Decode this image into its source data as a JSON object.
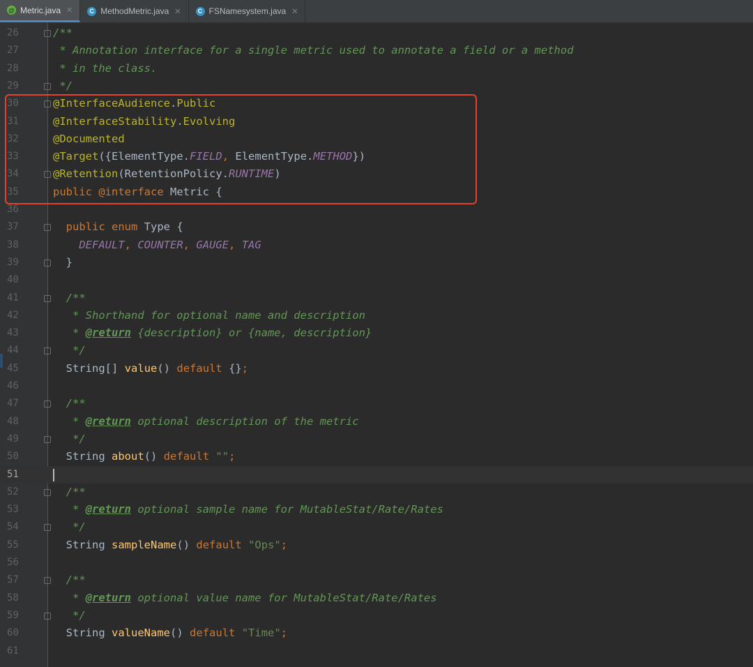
{
  "tabs": [
    {
      "label": "Metric.java",
      "icon": "annotation-icon",
      "active": true
    },
    {
      "label": "MethodMetric.java",
      "icon": "class-icon",
      "active": false
    },
    {
      "label": "FSNamesystem.java",
      "icon": "class-icon",
      "active": false
    }
  ],
  "colors": {
    "keyword": "#cc7832",
    "annotation": "#bbb529",
    "comment": "#629755",
    "constant": "#9876aa",
    "string": "#6a8759",
    "method": "#ffc66d",
    "highlight_box": "#e0432f"
  },
  "editor": {
    "current_line": 51,
    "lines": [
      {
        "n": "26",
        "t": "/**"
      },
      {
        "n": "27",
        "t": " * Annotation interface for a single metric used to annotate a field or a method"
      },
      {
        "n": "28",
        "t": " * in the class."
      },
      {
        "n": "29",
        "t": " */"
      },
      {
        "n": "30",
        "t": "@InterfaceAudience.Public"
      },
      {
        "n": "31",
        "t": "@InterfaceStability.Evolving"
      },
      {
        "n": "32",
        "t": "@Documented"
      },
      {
        "n": "33",
        "t": "@Target({ElementType.FIELD, ElementType.METHOD})"
      },
      {
        "n": "34",
        "t": "@Retention(RetentionPolicy.RUNTIME)"
      },
      {
        "n": "35",
        "t": "public @interface Metric {"
      },
      {
        "n": "36",
        "t": ""
      },
      {
        "n": "37",
        "t": "  public enum Type {"
      },
      {
        "n": "38",
        "t": "    DEFAULT, COUNTER, GAUGE, TAG"
      },
      {
        "n": "39",
        "t": "  }"
      },
      {
        "n": "40",
        "t": ""
      },
      {
        "n": "41",
        "t": "  /**"
      },
      {
        "n": "42",
        "t": "   * Shorthand for optional name and description"
      },
      {
        "n": "43",
        "t": "   * @return {description} or {name, description}"
      },
      {
        "n": "44",
        "t": "   */"
      },
      {
        "n": "45",
        "t": "  String[] value() default {};"
      },
      {
        "n": "46",
        "t": ""
      },
      {
        "n": "47",
        "t": "  /**"
      },
      {
        "n": "48",
        "t": "   * @return optional description of the metric"
      },
      {
        "n": "49",
        "t": "   */"
      },
      {
        "n": "50",
        "t": "  String about() default \"\";"
      },
      {
        "n": "51",
        "t": ""
      },
      {
        "n": "52",
        "t": "  /**"
      },
      {
        "n": "53",
        "t": "   * @return optional sample name for MutableStat/Rate/Rates"
      },
      {
        "n": "54",
        "t": "   */"
      },
      {
        "n": "55",
        "t": "  String sampleName() default \"Ops\";"
      },
      {
        "n": "56",
        "t": ""
      },
      {
        "n": "57",
        "t": "  /**"
      },
      {
        "n": "58",
        "t": "   * @return optional value name for MutableStat/Rate/Rates"
      },
      {
        "n": "59",
        "t": "   */"
      },
      {
        "n": "60",
        "t": "  String valueName() default \"Time\";"
      },
      {
        "n": "61",
        "t": ""
      }
    ]
  }
}
